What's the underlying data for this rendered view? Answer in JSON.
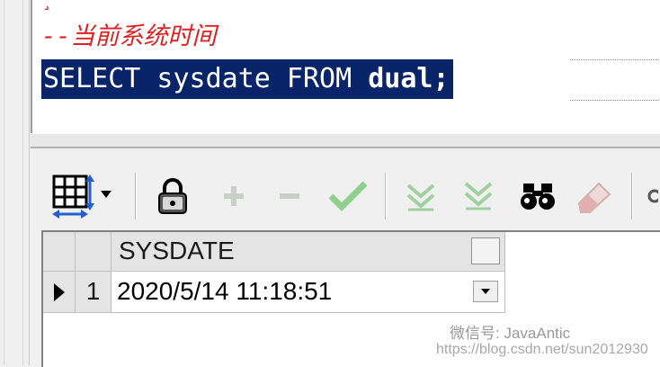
{
  "editor": {
    "comment": "--当前系统时间",
    "sql_keyword_select": "SELECT sysdate FROM ",
    "sql_table": "dual;"
  },
  "grid": {
    "column": "SYSDATE",
    "row_number": "1",
    "value": "2020/5/14 11:18:51"
  },
  "watermark": {
    "wechat": "微信号: JavaAntic",
    "url": "https://blog.csdn.net/sun2012930"
  },
  "colors": {
    "selection": "#0a246a",
    "comment": "#e02020",
    "post_green": "#8fd08f",
    "grid_header": "#e4e4e4"
  },
  "icons": [
    "grid-layout-icon",
    "lock-icon",
    "add-record-icon",
    "delete-record-icon",
    "post-changes-icon",
    "next-record-icon",
    "last-record-icon",
    "find-binoculars-icon",
    "clear-eraser-icon"
  ]
}
